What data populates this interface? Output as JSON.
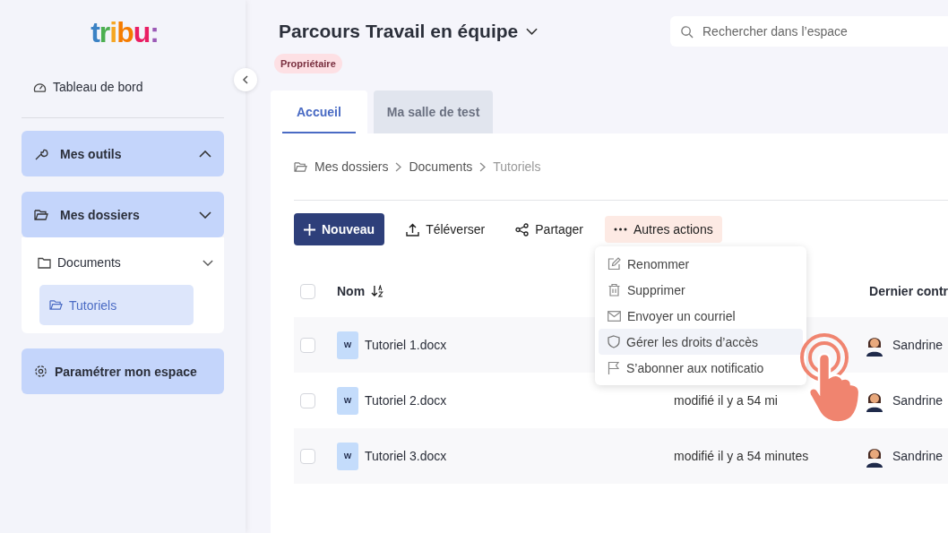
{
  "logo": "tribu:",
  "sidebar": {
    "dashboard": "Tableau de bord",
    "sections": [
      {
        "label": "Mes outils",
        "kind": "tools",
        "expanded": false
      },
      {
        "label": "Mes dossiers",
        "kind": "folders",
        "expanded": true,
        "children": [
          {
            "label": "Documents",
            "expanded": true,
            "selected": false,
            "children": [
              {
                "label": "Tutoriels",
                "selected": true
              }
            ]
          }
        ]
      }
    ],
    "settings": "Paramétrer mon espace"
  },
  "header": {
    "title": "Parcours Travail en équipe",
    "badge": "Propriétaire",
    "search": {
      "placeholder": "Rechercher dans l’espace"
    }
  },
  "tabs": [
    {
      "label": "Accueil",
      "selected": true
    },
    {
      "label": "Ma salle de test",
      "selected": false
    }
  ],
  "breadcrumb": [
    "Mes dossiers",
    "Documents",
    "Tutoriels"
  ],
  "toolbar": [
    {
      "label": "Nouveau",
      "kind": "new",
      "selected": false
    },
    {
      "label": "Téléverser",
      "kind": "upload",
      "selected": false
    },
    {
      "label": "Partager",
      "kind": "share",
      "selected": false
    },
    {
      "label": "Autres actions",
      "kind": "more",
      "selected": true
    }
  ],
  "menu": [
    {
      "label": "Renommer",
      "kind": "edit",
      "selected": false
    },
    {
      "label": "Supprimer",
      "kind": "trash",
      "selected": false
    },
    {
      "label": "Envoyer un courriel",
      "kind": "mail",
      "selected": false
    },
    {
      "label": "Gérer les droits d’accès",
      "kind": "shield",
      "selected": true
    },
    {
      "label": "S’abonner aux notificatio",
      "kind": "flag",
      "selected": false
    }
  ],
  "table": {
    "columns": [
      "Nom",
      "Dernier contr"
    ],
    "all_checked": false,
    "rows": [
      {
        "checked": false,
        "file_badge": "W",
        "name": "Tutoriel 1.docx",
        "owner": "Sandrine"
      },
      {
        "checked": false,
        "file_badge": "W",
        "name": "Tutoriel 2.docx",
        "modified": "modifié il y a 54 mi",
        "owner": "Sandrine"
      },
      {
        "checked": false,
        "file_badge": "W",
        "name": "Tutoriel 3.docx",
        "modified": "modifié il y a 54 minutes",
        "owner": "Sandrine"
      }
    ]
  }
}
